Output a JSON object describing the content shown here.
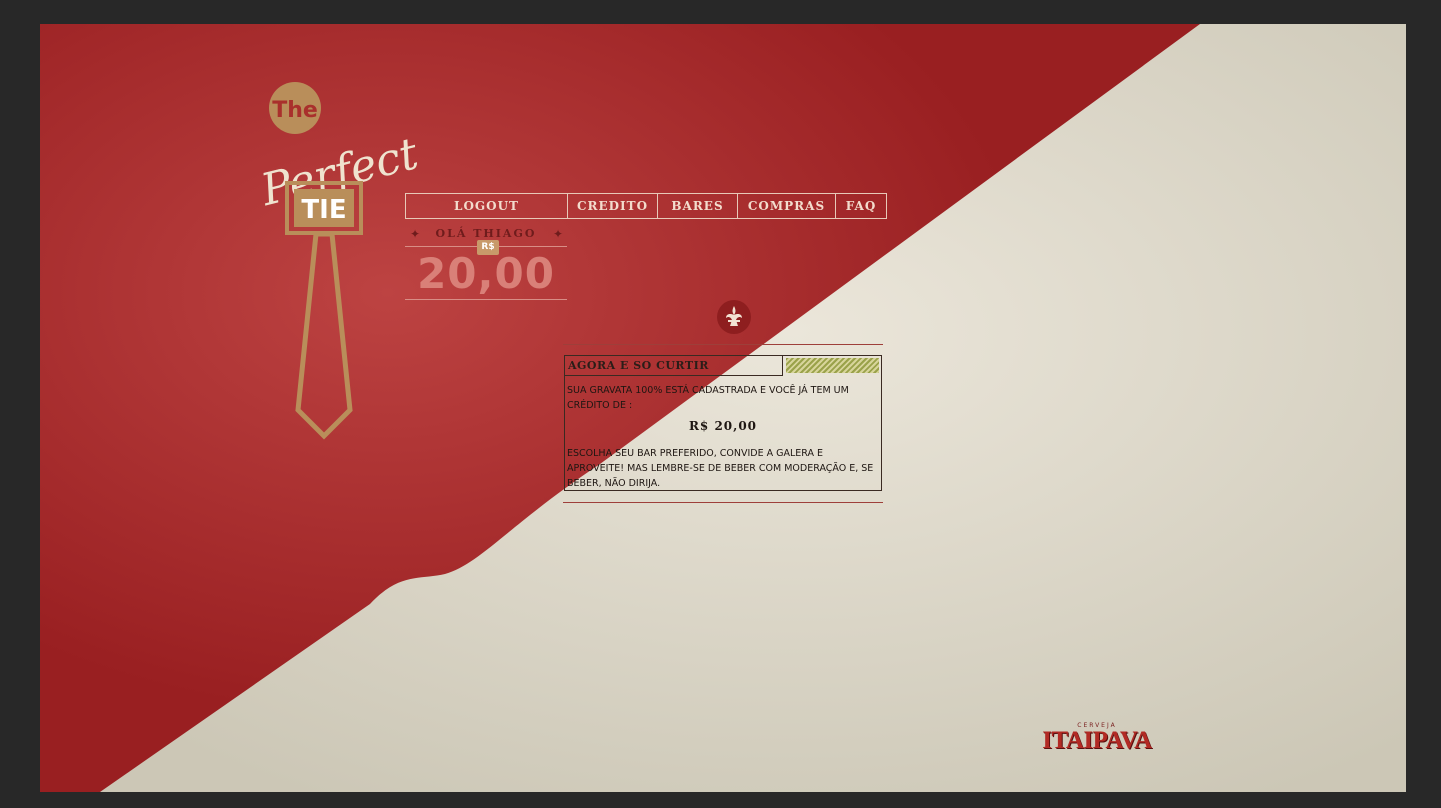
{
  "logo": {
    "line1": "The",
    "line2": "Perfect",
    "line3": "TIE"
  },
  "nav": {
    "items": [
      {
        "label": "LOGOUT"
      },
      {
        "label": "CREDITO"
      },
      {
        "label": "BARES"
      },
      {
        "label": "COMPRAS"
      },
      {
        "label": "FAQ"
      }
    ]
  },
  "greeting": {
    "name": "OLÁ THIAGO",
    "currency": "R$",
    "balance": "20,00"
  },
  "panel": {
    "title": "AGORA E SO CURTIR",
    "text1": "SUA GRAVATA 100% ESTÁ CADASTRADA E VOCÊ JÁ TEM UM CRÉDITO DE :",
    "amount": "R$ 20,00",
    "text2": "ESCOLHA SEU BAR PREFERIDO, CONVIDE A GALERA E APROVEITE! MAS LEMBRE-SE DE BEBER COM MODERAÇÃO E, SE BEBER, NÃO DIRIJA."
  },
  "brand": {
    "sub": "CERVEJA",
    "name": "ITAIPAVA"
  },
  "colors": {
    "red": "#a41f22",
    "cream": "#dcd6c8",
    "gold": "#b98e5a"
  }
}
